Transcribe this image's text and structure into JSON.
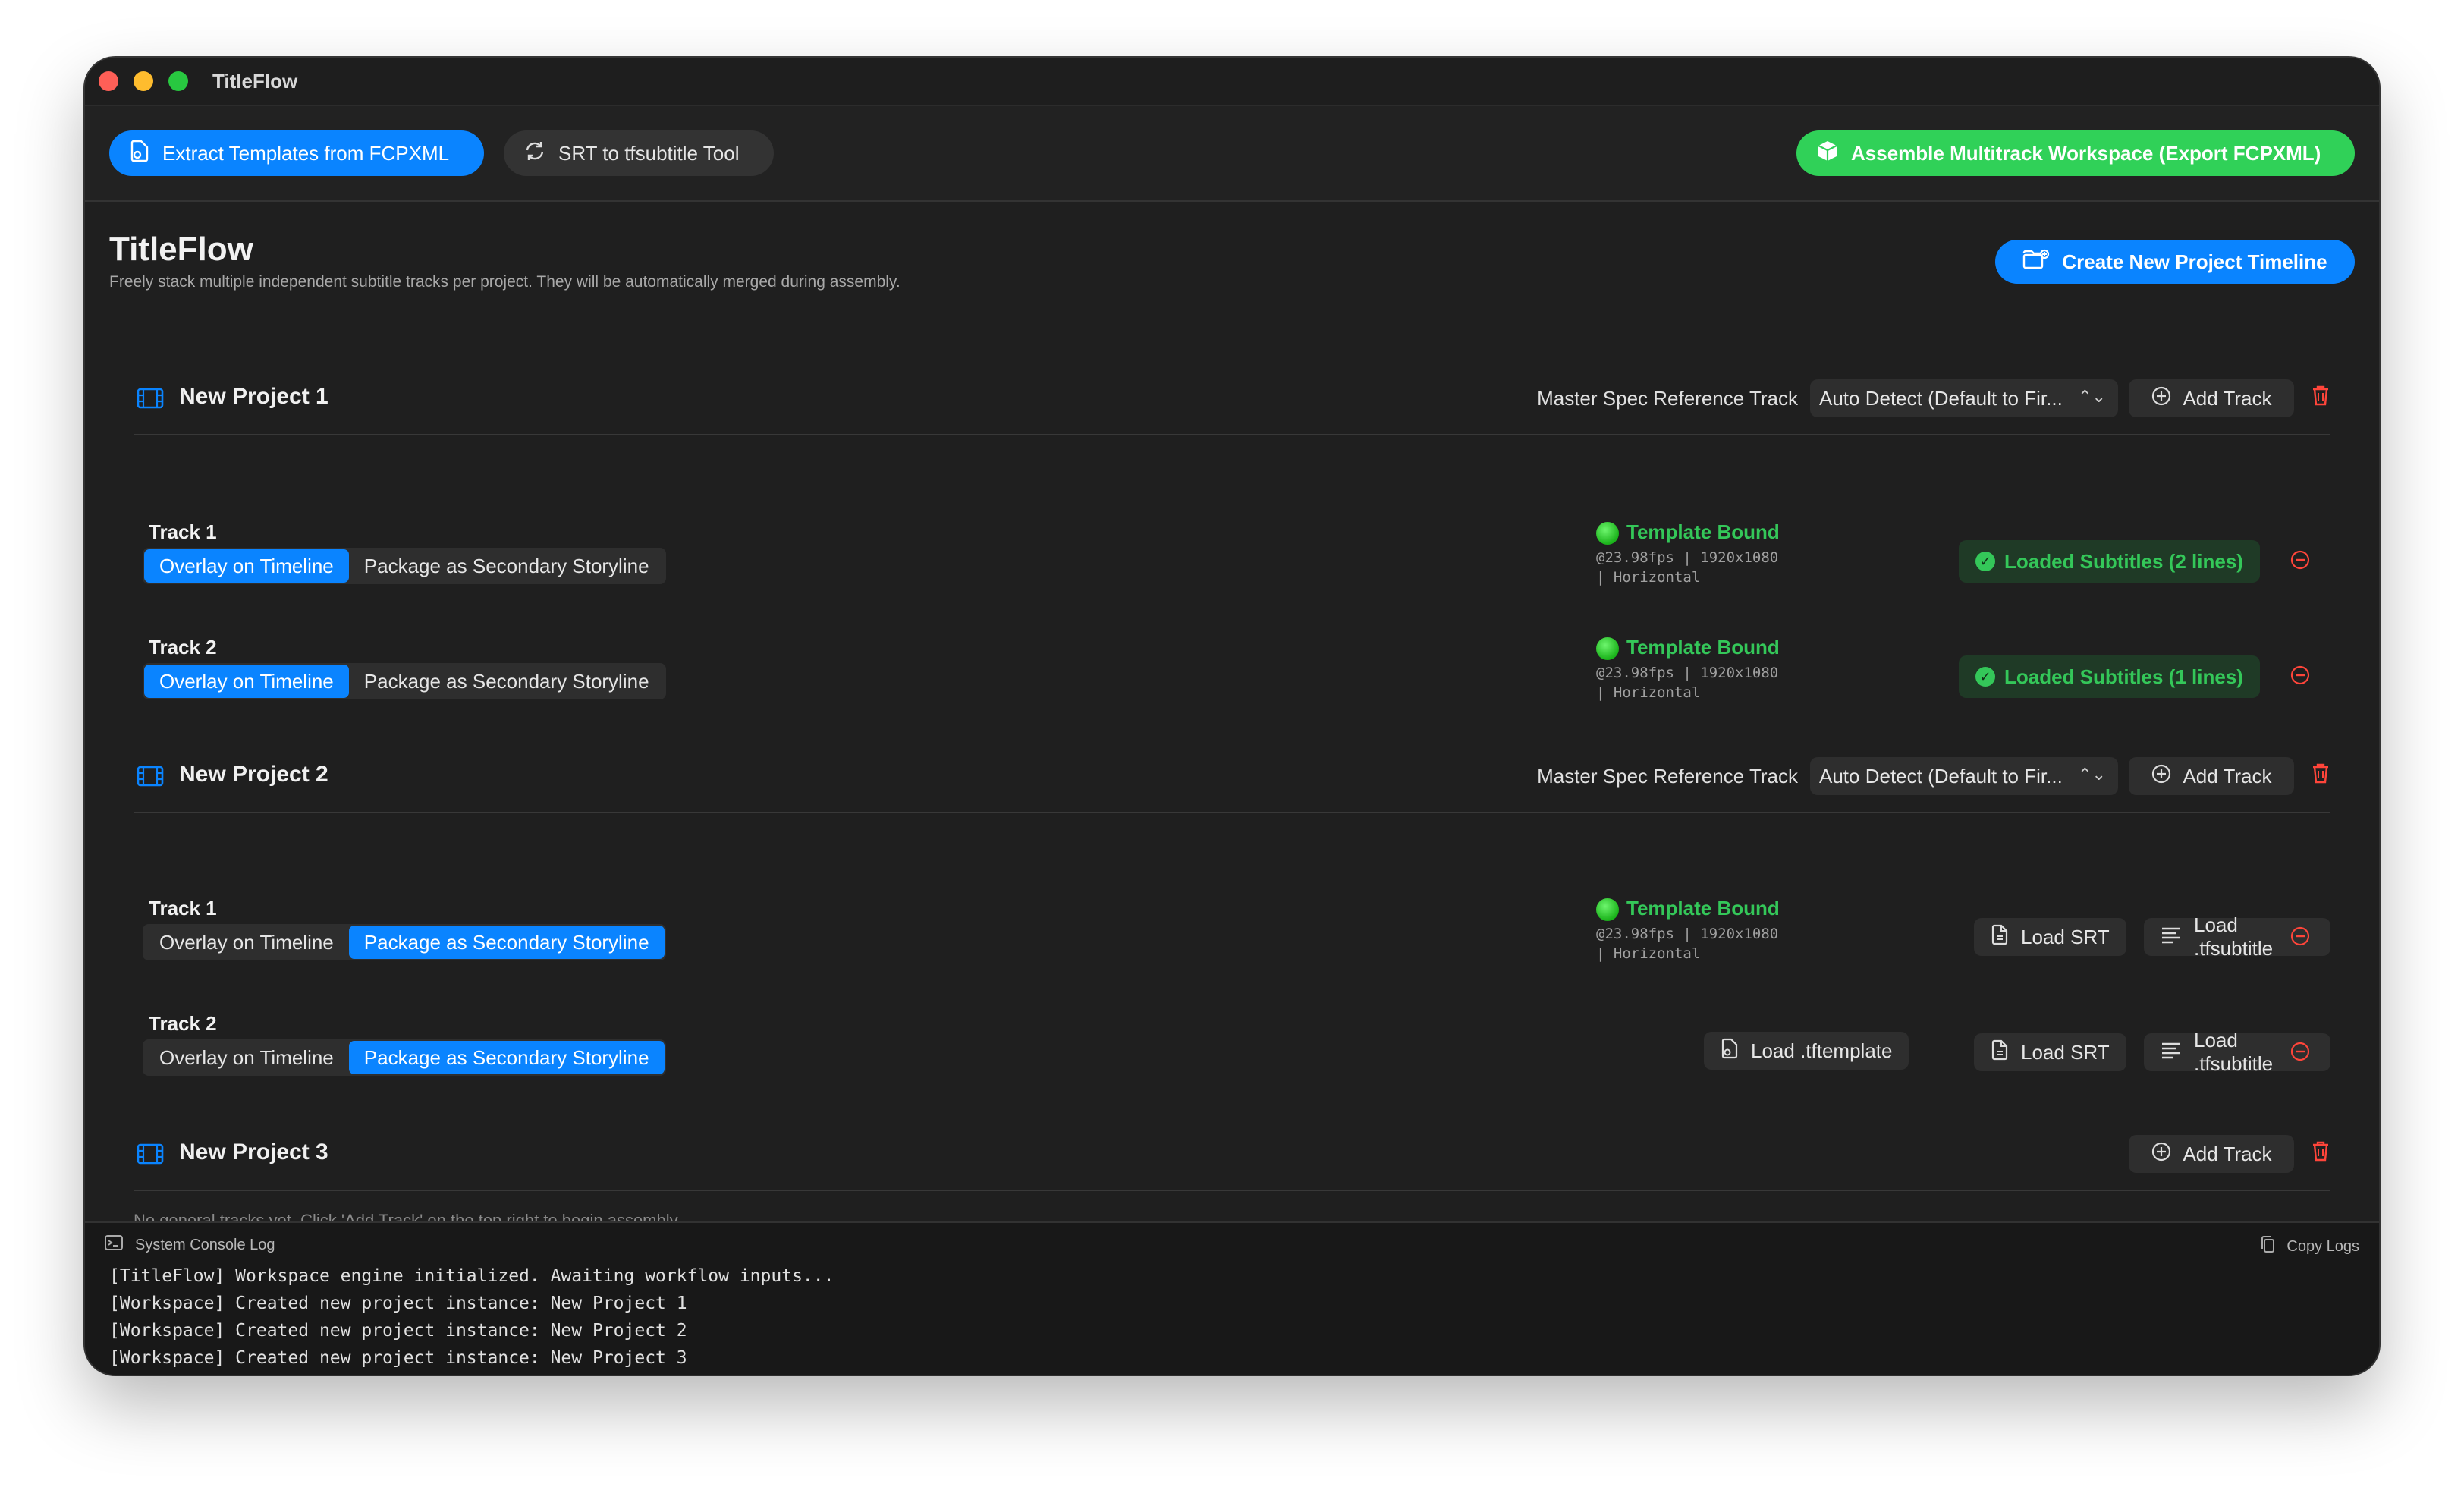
{
  "window": {
    "title": "TitleFlow"
  },
  "toolbar": {
    "extract_label": "Extract Templates from FCPXML",
    "srt_tool_label": "SRT to tfsubtitle Tool",
    "assemble_label": "Assemble Multitrack Workspace (Export FCPXML)"
  },
  "header": {
    "title": "TitleFlow",
    "subtitle": "Freely stack multiple independent subtitle tracks per project. They will be automatically merged during assembly.",
    "create_label": "Create New Project Timeline"
  },
  "common": {
    "master_label": "Master Spec Reference Track",
    "master_value": "Auto Detect (Default to Fir...",
    "add_track": "Add Track",
    "overlay": "Overlay on Timeline",
    "package": "Package as Secondary Storyline",
    "template_bound": "Template Bound",
    "meta_line1": "@23.98fps | 1920x1080",
    "meta_line2": "| Horizontal",
    "load_srt": "Load SRT",
    "load_tfsubtitle": "Load .tfsubtitle",
    "load_tftemplate": "Load .tftemplate"
  },
  "projects": [
    {
      "name": "New Project 1",
      "tracks": [
        {
          "name": "Track 1",
          "mode": "overlay",
          "loaded": "Loaded Subtitles (2 lines)"
        },
        {
          "name": "Track 2",
          "mode": "overlay",
          "loaded": "Loaded Subtitles (1 lines)"
        }
      ]
    },
    {
      "name": "New Project 2",
      "tracks": [
        {
          "name": "Track 1",
          "mode": "package"
        },
        {
          "name": "Track 2",
          "mode": "package"
        }
      ]
    },
    {
      "name": "New Project 3",
      "tracks": []
    }
  ],
  "console": {
    "title": "System Console Log",
    "copy_label": "Copy Logs",
    "peek_text": "No general tracks yet. Click 'Add Track' on the top right to begin assembly.",
    "lines": [
      "[TitleFlow] Workspace engine initialized. Awaiting workflow inputs...",
      "[Workspace] Created new project instance: New Project 1",
      "[Workspace] Created new project instance: New Project 2",
      "[Workspace] Created new project instance: New Project 3"
    ]
  },
  "colors": {
    "accent": "#0a84ff",
    "success": "#34c759",
    "danger": "#ff453a",
    "background": "#1f1f1f"
  },
  "icons": [
    "doc-icon",
    "sync-icon",
    "cube-icon",
    "folder-add-icon",
    "film-icon",
    "plus-circle-icon",
    "trash-icon",
    "minus-circle-icon",
    "checkmark-icon",
    "terminal-icon",
    "copy-icon",
    "lines-icon"
  ]
}
